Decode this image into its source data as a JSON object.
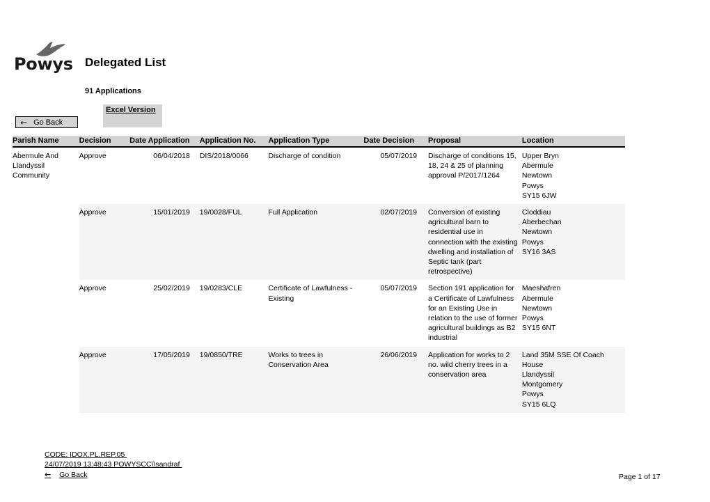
{
  "logo": {
    "wordmark": "Powys",
    "icon": "red-kite-bird-icon"
  },
  "header": {
    "title": "Delegated List",
    "application_count": "91 Applications",
    "excel_link": "Excel Version",
    "go_back_label": "Go Back",
    "go_back_arrow": "←"
  },
  "table": {
    "columns": [
      "Parish Name",
      "Decision",
      "Date Application",
      "Application No.",
      "Application Type",
      "Date Decision",
      "Proposal",
      "Location"
    ],
    "rows": [
      {
        "parish": "Abermule And Llandyssil Community",
        "decision": "Approve",
        "date_application": "06/04/2018",
        "application_no": "DIS/2018/0066",
        "application_type": "Discharge of condition",
        "date_decision": "05/07/2019",
        "proposal": "Discharge of conditions 15, 18, 24 & 25 of planning approval P/2017/1264",
        "location": "Upper Bryn\nAbermule\nNewtown\nPowys\nSY15 6JW",
        "shaded": false
      },
      {
        "parish": "",
        "decision": "Approve",
        "date_application": "15/01/2019",
        "application_no": "19/0028/FUL",
        "application_type": "Full Application",
        "date_decision": "02/07/2019",
        "proposal": "Conversion of existing agricultural barn to residential use in connection with the existing dwelling and installation of Septic tank (part retrospective)",
        "location": "Cloddiau\nAberbechan\nNewtown\nPowys\nSY16 3AS",
        "shaded": true
      },
      {
        "parish": "",
        "decision": "Approve",
        "date_application": "25/02/2019",
        "application_no": "19/0283/CLE",
        "application_type": "Certificate of Lawfulness - Existing",
        "date_decision": "05/07/2019",
        "proposal": "Section 191 application for a Certificate of Lawfulness for an Existing Use in relation to the use of former agricultural buildings as B2 industrial",
        "location": "Maeshafren\nAbermule\nNewtown\nPowys\nSY15 6NT",
        "shaded": false
      },
      {
        "parish": "",
        "decision": "Approve",
        "date_application": "17/05/2019",
        "application_no": "19/0850/TRE",
        "application_type": "Works to trees in Conservation Area",
        "date_decision": "26/06/2019",
        "proposal": "Application for works to 2 no. wild cherry trees in a conservation area",
        "location": "Land 35M SSE Of Coach House\nLlandyssil\nMontgomery\nPowys\nSY15 6LQ",
        "shaded": true
      }
    ]
  },
  "footer": {
    "code_line": "CODE: IDOX.PL.REP.05 ",
    "timestamp_line": "24/07/2019 13:48:43 POWYSCC\\\\sandraf ",
    "go_back_label": "Go Back",
    "go_back_arrow": "←",
    "page_number": "Page 1 of 17"
  },
  "colors": {
    "header_band": "#d4d4d4",
    "row_shade": "#f4f4f4",
    "text": "#000000"
  }
}
